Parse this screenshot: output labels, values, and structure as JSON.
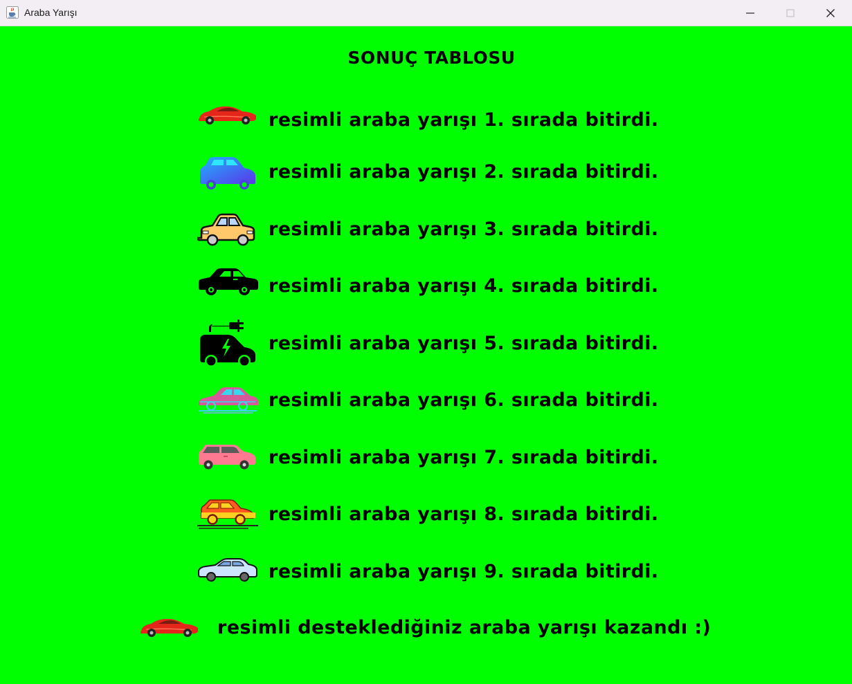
{
  "window": {
    "title": "Araba Yarışı",
    "icon": "java-cup-icon",
    "controls": [
      "minimize-icon",
      "maximize-icon",
      "close-icon"
    ]
  },
  "colors": {
    "background": "#00ff00",
    "text": "#000000",
    "titlebar": "#f3eef4"
  },
  "heading": "SONUÇ TABLOSU",
  "results": [
    {
      "car_icon": "red-sports-car-icon",
      "text": "resimli araba yarışı 1. sırada bitirdi."
    },
    {
      "car_icon": "blue-gradient-car-icon",
      "text": "resimli araba yarışı 2. sırada bitirdi."
    },
    {
      "car_icon": "yellow-taxi-car-icon",
      "text": "resimli araba yarışı 3. sırada bitirdi."
    },
    {
      "car_icon": "black-sedan-icon",
      "text": "resimli araba yarışı 4. sırada bitirdi."
    },
    {
      "car_icon": "electric-car-icon",
      "text": "resimli araba yarışı 5. sırada bitirdi."
    },
    {
      "car_icon": "pink-outline-car-icon",
      "text": "resimli araba yarışı 6. sırada bitirdi."
    },
    {
      "car_icon": "pink-hatchback-icon",
      "text": "resimli araba yarışı 7. sırada bitirdi."
    },
    {
      "car_icon": "orange-suv-icon",
      "text": "resimli araba yarışı 8. sırada bitirdi."
    },
    {
      "car_icon": "light-blue-sedan-icon",
      "text": "resimli araba yarışı 9. sırada bitirdi."
    }
  ],
  "winner": {
    "car_icon": "red-sports-car-icon",
    "text": "resimli desteklediğiniz araba yarışı kazandı :)"
  }
}
